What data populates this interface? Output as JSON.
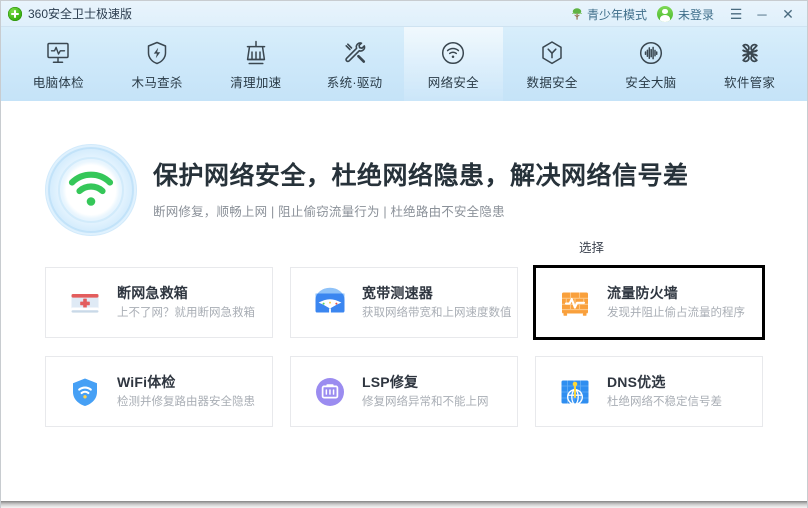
{
  "titlebar": {
    "app_name": "360安全卫士极速版",
    "logo_icon": "360-logo-icon",
    "youth_mode": {
      "label": "青少年模式",
      "icon": "tree-icon"
    },
    "account": {
      "label": "未登录",
      "icon": "avatar-icon"
    },
    "menu_button": "☰",
    "minimize_button": "─",
    "close_button": "✕"
  },
  "nav": {
    "items": [
      {
        "label": "电脑体检",
        "icon": "monitor-pulse-icon",
        "active": false
      },
      {
        "label": "木马查杀",
        "icon": "shield-bolt-icon",
        "active": false
      },
      {
        "label": "清理加速",
        "icon": "broom-icon",
        "active": false
      },
      {
        "label": "系统·驱动",
        "icon": "wrench-screwdriver-icon",
        "active": false
      },
      {
        "label": "网络安全",
        "icon": "wifi-circle-icon",
        "active": true
      },
      {
        "label": "数据安全",
        "icon": "hexagon-icon",
        "active": false
      },
      {
        "label": "安全大脑",
        "icon": "brain-waveform-icon",
        "active": false
      },
      {
        "label": "软件管家",
        "icon": "four-petal-icon",
        "active": false
      }
    ]
  },
  "hero": {
    "icon": "wifi-signal-icon",
    "title": "保护网络安全，杜绝网络隐患，解决网络信号差",
    "subtitle": "断网修复，顺畅上网  |  阻止偷窃流量行为  |  杜绝路由不安全隐患"
  },
  "select_label": "选择",
  "cards": {
    "rows": [
      [
        {
          "title": "断网急救箱",
          "desc": "上不了网？就用断网急救箱",
          "icon": "first-aid-kit-icon",
          "color": "#e35d5d",
          "highlighted": false
        },
        {
          "title": "宽带测速器",
          "desc": "获取网络带宽和上网速度数值",
          "icon": "speedometer-icon",
          "color": "#3b86f0",
          "highlighted": false
        },
        {
          "title": "流量防火墙",
          "desc": "发现并阻止偷占流量的程序",
          "icon": "firewall-wave-icon",
          "color": "#f9a03c",
          "highlighted": true
        }
      ],
      [
        {
          "title": "WiFi体检",
          "desc": "检测并修复路由器安全隐患",
          "icon": "shield-wifi-icon",
          "color": "#46a0f5",
          "highlighted": false
        },
        {
          "title": "LSP修复",
          "desc": "修复网络异常和不能上网",
          "icon": "ethernet-port-icon",
          "color": "#9b8cf0",
          "highlighted": false
        },
        {
          "title": "DNS优选",
          "desc": "杜绝网络不稳定信号差",
          "icon": "globe-antenna-icon",
          "color": "#2f8ef0",
          "highlighted": false
        }
      ]
    ]
  },
  "colors": {
    "accent_blue": "#2f8ef0",
    "nav_bg_top": "#d8eefb",
    "nav_bg_bottom": "#c5e3f8",
    "highlight_border": "#000000",
    "title_text": "#27323a",
    "muted_text": "#a9aeb5"
  }
}
